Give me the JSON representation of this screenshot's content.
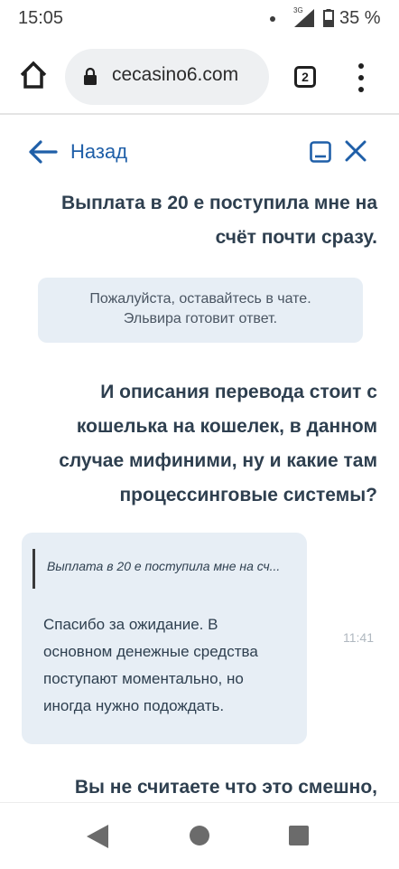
{
  "status_bar": {
    "time": "15:05",
    "network": "3G",
    "battery": "35 %"
  },
  "browser": {
    "url": "сecasino6.com",
    "tab_count": "2"
  },
  "chat": {
    "back_label": "Назад",
    "accent_color": "#1f5fa8",
    "messages": [
      {
        "from": "user",
        "lines": [
          "Выплата в 20 е поступила мне на",
          "счёт почти сразу."
        ]
      },
      {
        "from": "system",
        "lines": [
          "Пожалуйста, оставайтесь в чате.",
          "Эльвира готовит ответ."
        ]
      },
      {
        "from": "user",
        "lines": [
          "И описания перевода стоит с",
          "кошелька на кошелек, в данном",
          "случае мифиними, ну и какие там",
          "процессинговые системы?"
        ]
      },
      {
        "from": "agent",
        "quote": "Выплата в 20 е поступила мне на сч...",
        "lines": [
          "Спасибо за ожидание. В",
          "основном денежные средства",
          "поступают моментально, но",
          "иногда нужно подождать."
        ],
        "time": "11:41"
      },
      {
        "from": "user",
        "lines": [
          "Вы не считаете что это смешно,"
        ]
      }
    ]
  },
  "nav_bar": {
    "icons": [
      "back-triangle-icon",
      "home-circle-icon",
      "recents-square-icon"
    ]
  }
}
